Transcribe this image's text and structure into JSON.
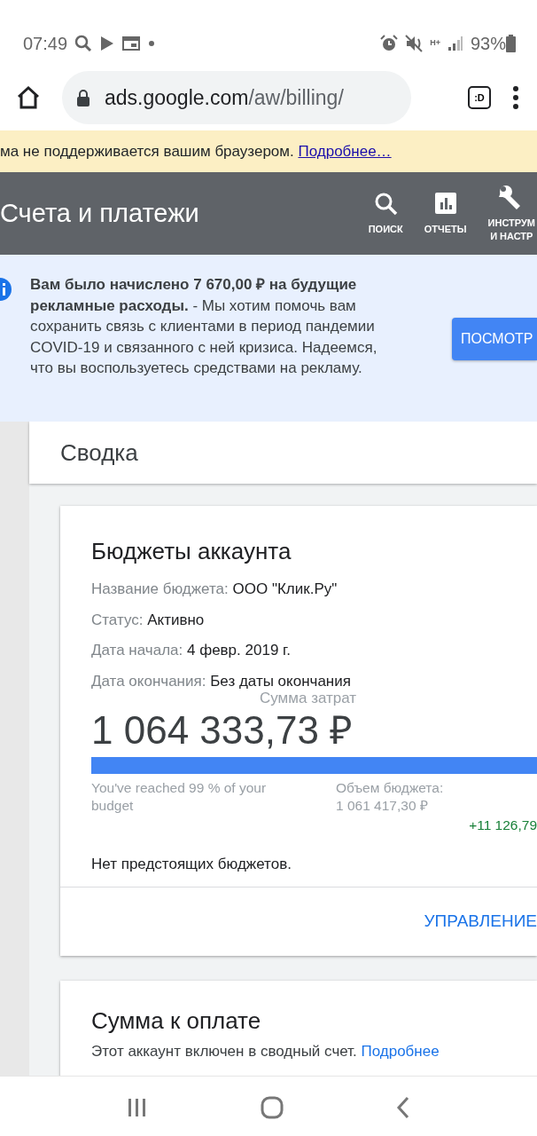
{
  "status_bar": {
    "time": "07:49",
    "network": "H+",
    "battery": "93%"
  },
  "browser": {
    "url_host": "ads.google.com",
    "url_path": "/aw/billing/",
    "tab_switcher": ":D"
  },
  "warning": {
    "text": "ма не поддерживается вашим браузером.",
    "link": "Подробнее…"
  },
  "header": {
    "title": "Счета и платежи",
    "actions": [
      {
        "kind": "search",
        "label": "ПОИСК"
      },
      {
        "kind": "reports",
        "label": "ОТЧЕТЫ"
      },
      {
        "kind": "tools",
        "label": "ИНСТРУМ\nИ НАСТР"
      }
    ]
  },
  "notice": {
    "text": "**Вам было начислено 7 670,00 ₽ на будущие рекламные расходы.** - Мы хотим помочь вам сохранить связь с клиентами в период пандемии COVID-19 и связанного с ней кризиса. Надеемся, что вы воспользуетесь средствами на рекламу.",
    "button": "ПОСМОТР"
  },
  "summary_title": "Сводка",
  "budget_card": {
    "title": "Бюджеты аккаунта",
    "fields": [
      {
        "label": "Название бюджета:",
        "value": "ООО \"Клик.Ру\""
      },
      {
        "label": "Статус:",
        "value": "Активно"
      },
      {
        "label": "Дата начала:",
        "value": "4 февр. 2019 г."
      },
      {
        "label": "Дата окончания:",
        "value": "Без даты окончания"
      }
    ],
    "spend_label": "Сумма затрат",
    "spend": "1 064 333,73 ₽",
    "level": 1,
    "reached": "You've reached 99 % of your budget",
    "volume_label": "Объем бюджета:",
    "volume": "1 061 417,30 ₽",
    "overage": "+11 126,79",
    "no_upcoming": "Нет предстоящих бюджетов.",
    "action": "УПРАВЛЕНИЕ"
  },
  "payment_card": {
    "title": "Сумма к оплате",
    "text": "Этот аккаунт включен в сводный счет.",
    "link": "Подробнее"
  }
}
